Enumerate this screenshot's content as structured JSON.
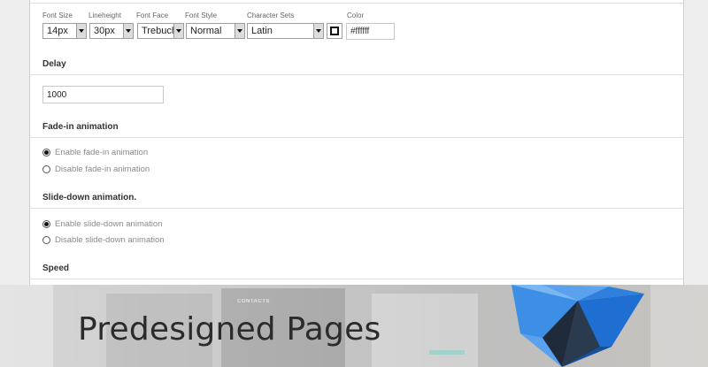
{
  "font_settings": {
    "labels": {
      "font_size": "Font Size",
      "lineheight": "Lineheight",
      "font_face": "Font Face",
      "font_style": "Font Style",
      "character_sets": "Character Sets",
      "color": "Color"
    },
    "font_size_value": "14px",
    "lineheight_value": "30px",
    "font_face_value": "Trebuchet",
    "font_style_value": "Normal",
    "character_sets_value": "Latin",
    "color_value": "#ffffff"
  },
  "delay": {
    "title": "Delay",
    "value": "1000"
  },
  "fade_in": {
    "title": "Fade-in animation",
    "options": [
      {
        "label": "Enable fade-in animation",
        "checked": true
      },
      {
        "label": "Disable fade-in animation",
        "checked": false
      }
    ]
  },
  "slide_down": {
    "title": "Slide-down animation.",
    "options": [
      {
        "label": "Enable slide-down animation",
        "checked": true
      },
      {
        "label": "Disable slide-down animation",
        "checked": false
      }
    ]
  },
  "speed": {
    "title": "Speed"
  },
  "banner": {
    "title": "Predesigned Pages",
    "ghost_label": "CONTACTS"
  },
  "colors": {
    "logo_blue": "#2f7fdc",
    "logo_dark": "#1f2b3a",
    "banner_text": "#2b2b2b"
  }
}
